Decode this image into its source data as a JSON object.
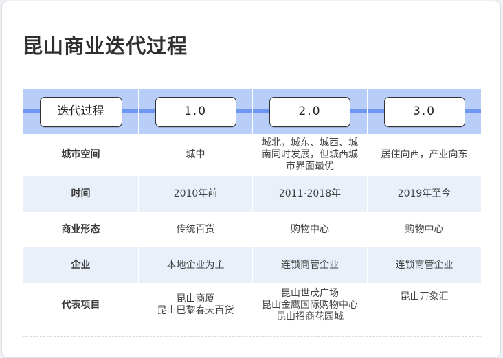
{
  "title": "昆山商业迭代过程",
  "header": {
    "label": "迭代过程",
    "versions": [
      "1.0",
      "2.0",
      "3.0"
    ]
  },
  "rows": [
    {
      "label": "城市空间",
      "values": [
        [
          "城中"
        ],
        [
          "城北，城东、城西、城",
          "南同时发展，但城西城",
          "市界面最优"
        ],
        [
          "居住向西，产业向东"
        ]
      ]
    },
    {
      "label": "时间",
      "values": [
        [
          "2010年前"
        ],
        [
          "2011-2018年"
        ],
        [
          "2019年至今"
        ]
      ]
    },
    {
      "label": "商业形态",
      "values": [
        [
          "传统百货"
        ],
        [
          "购物中心"
        ],
        [
          "购物中心"
        ]
      ]
    },
    {
      "label": "企业",
      "values": [
        [
          "本地企业为主"
        ],
        [
          "连锁商管企业"
        ],
        [
          "连锁商管企业"
        ]
      ]
    },
    {
      "label": "代表项目",
      "values": [
        [
          "昆山商厦",
          "昆山巴黎春天百货"
        ],
        [
          "昆山世茂广场",
          "昆山金鹰国际购物中心",
          "昆山招商花园城"
        ],
        [
          "昆山万象汇"
        ]
      ]
    }
  ],
  "colors": {
    "header_band": "#b8cef8",
    "timeline": "#6d98f1",
    "stripe": "#e9f0fa"
  }
}
